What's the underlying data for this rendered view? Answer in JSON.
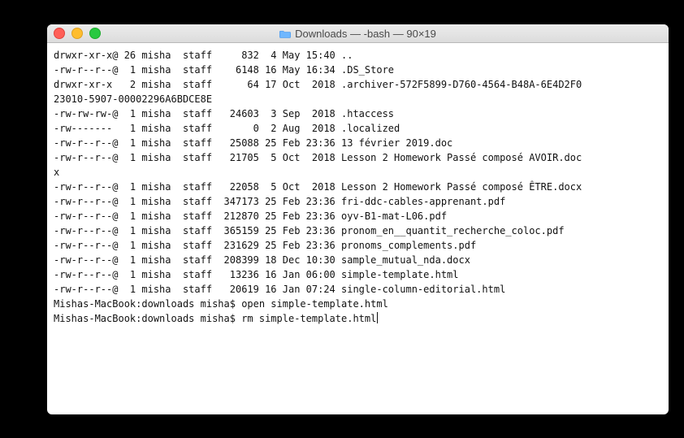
{
  "window": {
    "title": "Downloads — -bash — 90×19"
  },
  "listing": [
    {
      "perms": "drwxr-xr-x@",
      "links": "26",
      "owner": "misha",
      "group": "staff",
      "size": "832",
      "date": " 4 May 15:40",
      "name": ".."
    },
    {
      "perms": "-rw-r--r--@",
      "links": " 1",
      "owner": "misha",
      "group": "staff",
      "size": "6148",
      "date": "16 May 16:34",
      "name": ".DS_Store"
    },
    {
      "perms": "drwxr-xr-x ",
      "links": " 2",
      "owner": "misha",
      "group": "staff",
      "size": "64",
      "date": "17 Oct  2018",
      "name": ".archiver-572F5899-D760-4564-B48A-6E4D2F0"
    },
    {
      "wrap": "23010-5907-00002296A6BDCE8E"
    },
    {
      "perms": "-rw-rw-rw-@",
      "links": " 1",
      "owner": "misha",
      "group": "staff",
      "size": "24603",
      "date": " 3 Sep  2018",
      "name": ".htaccess"
    },
    {
      "perms": "-rw------- ",
      "links": " 1",
      "owner": "misha",
      "group": "staff",
      "size": "0",
      "date": " 2 Aug  2018",
      "name": ".localized"
    },
    {
      "perms": "-rw-r--r--@",
      "links": " 1",
      "owner": "misha",
      "group": "staff",
      "size": "25088",
      "date": "25 Feb 23:36",
      "name": "13 février 2019.doc"
    },
    {
      "perms": "-rw-r--r--@",
      "links": " 1",
      "owner": "misha",
      "group": "staff",
      "size": "21705",
      "date": " 5 Oct  2018",
      "name": "Lesson 2 Homework Passé composé AVOIR.doc"
    },
    {
      "wrap": "x"
    },
    {
      "perms": "-rw-r--r--@",
      "links": " 1",
      "owner": "misha",
      "group": "staff",
      "size": "22058",
      "date": " 5 Oct  2018",
      "name": "Lesson 2 Homework Passé composé ÊTRE.docx"
    },
    {
      "perms": "-rw-r--r--@",
      "links": " 1",
      "owner": "misha",
      "group": "staff",
      "size": "347173",
      "date": "25 Feb 23:36",
      "name": "fri-ddc-cables-apprenant.pdf"
    },
    {
      "perms": "-rw-r--r--@",
      "links": " 1",
      "owner": "misha",
      "group": "staff",
      "size": "212870",
      "date": "25 Feb 23:36",
      "name": "oyv-B1-mat-L06.pdf"
    },
    {
      "perms": "-rw-r--r--@",
      "links": " 1",
      "owner": "misha",
      "group": "staff",
      "size": "365159",
      "date": "25 Feb 23:36",
      "name": "pronom_en__quantit_recherche_coloc.pdf"
    },
    {
      "perms": "-rw-r--r--@",
      "links": " 1",
      "owner": "misha",
      "group": "staff",
      "size": "231629",
      "date": "25 Feb 23:36",
      "name": "pronoms_complements.pdf"
    },
    {
      "perms": "-rw-r--r--@",
      "links": " 1",
      "owner": "misha",
      "group": "staff",
      "size": "208399",
      "date": "18 Dec 10:30",
      "name": "sample_mutual_nda.docx"
    },
    {
      "perms": "-rw-r--r--@",
      "links": " 1",
      "owner": "misha",
      "group": "staff",
      "size": "13236",
      "date": "16 Jan 06:00",
      "name": "simple-template.html"
    },
    {
      "perms": "-rw-r--r--@",
      "links": " 1",
      "owner": "misha",
      "group": "staff",
      "size": "20619",
      "date": "16 Jan 07:24",
      "name": "single-column-editorial.html"
    }
  ],
  "prompts": [
    {
      "prefix": "Mishas-MacBook:downloads misha$ ",
      "cmd": "open simple-template.html",
      "cursor": false
    },
    {
      "prefix": "Mishas-MacBook:downloads misha$ ",
      "cmd": "rm simple-template.html",
      "cursor": true
    }
  ]
}
